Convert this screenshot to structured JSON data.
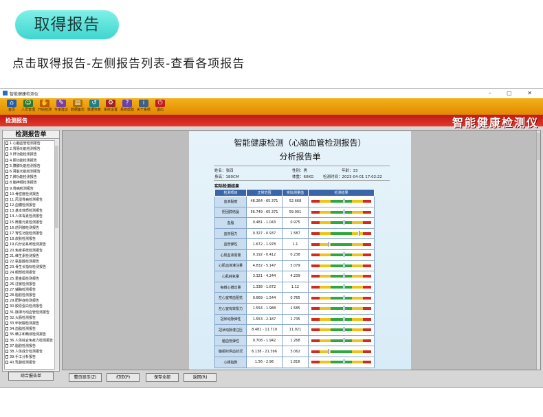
{
  "banner": {
    "title": "取得报告"
  },
  "caption": "点击取得报告-左侧报告列表-查看各项报告",
  "window": {
    "title": "智能健康检测仪",
    "controls": "–  ▢  ✕"
  },
  "toolbar": {
    "items": [
      {
        "label": "首页",
        "icon": "home-icon",
        "color": "#1f5fae"
      },
      {
        "label": "人员管理",
        "icon": "people-icon",
        "color": "#2b7a2b"
      },
      {
        "label": "开始检测",
        "icon": "hand-icon",
        "color": "#c05a00"
      },
      {
        "label": "专家建议",
        "icon": "expert-icon",
        "color": "#7b3fa0"
      },
      {
        "label": "数据备份",
        "icon": "backup-icon",
        "color": "#b07000"
      },
      {
        "label": "数据恢复",
        "icon": "restore-icon",
        "color": "#1f7e8a"
      },
      {
        "label": "系统设置",
        "icon": "settings-icon",
        "color": "#a32121"
      },
      {
        "label": "系统帮助",
        "icon": "help-icon",
        "color": "#6a3fb0"
      },
      {
        "label": "关于系统",
        "icon": "about-icon",
        "color": "#3e5f8a"
      },
      {
        "label": "退出",
        "icon": "exit-icon",
        "color": "#c41e1e"
      }
    ]
  },
  "section_label": "检测报告",
  "brand": "智能健康检测仪",
  "sidebar": {
    "title": "检测报告单",
    "items": [
      "1.心脑血管检测报告",
      "2.胃肠功能检测报告",
      "3.肝功能检测报告",
      "4.胆功能检测报告",
      "5.胰腺功能检测报告",
      "6.肾脏功能检测报告",
      "7.肺功能检测报告",
      "8.脑神经检测报告",
      "9.骨病检测报告",
      "10.骨密度检测报告",
      "11.风湿骨病检测报告",
      "12.血糖检测报告",
      "13.基本体质检测报告",
      "14.人体毒素检测报告",
      "15.微量元素检测报告",
      "16.前列腺检测报告",
      "17.胃性功能检测报告",
      "18.皮肤检测报告",
      "19.内分泌系统检测报告",
      "20.免疫系统检测报告",
      "21.维生素检测报告",
      "22.氨基酸检测报告",
      "23.骨生长指标检测报告",
      "24.眼部检测报告",
      "25.重金属检测报告",
      "26.过敏检测报告",
      "27.辅酶检测报告",
      "28.脂肪检测报告",
      "29.肥胖症检测报告",
      "30.胶原蛋白检测报告",
      "31.脉搏与动血管检测报告",
      "32.大肠检测报告",
      "33.甲状腺检测报告",
      "34.血脂检测报告",
      "35.精子和精液检测报告",
      "36.人体综合免疫力检测报告",
      "37.脂肪检测报告",
      "38.人体成分检测报告",
      "39.手工分析报告",
      "40.乳腺检测报告"
    ],
    "button": "综合报告单"
  },
  "buttons": {
    "show_full": "整页显示(Z)",
    "print": "打印(P)",
    "save_all": "保存全部",
    "back": "返回(R)"
  },
  "report": {
    "title": "智能健康检测（心脑血管检测报告）",
    "subtitle": "分析报告单",
    "name": "姓名：张四",
    "gender": "性别：男",
    "age": "年龄：33",
    "height": "身高：180CM",
    "weight": "体重：60KG",
    "time": "检测时间：2023-04-01 17:02:22",
    "section": "实际检测结果",
    "headers": [
      "检测项目",
      "正常范围",
      "实际测量值",
      "检测结果"
    ],
    "rows": [
      {
        "name": "血液黏度",
        "range": "48.264 - 65.371",
        "value": "52.668",
        "level": 0.55
      },
      {
        "name": "胆固醇结晶",
        "range": "56.749 - 65.371",
        "value": "59.901",
        "level": 0.55
      },
      {
        "name": "血脂",
        "range": "0.481 - 1.043",
        "value": "0.975",
        "level": 0.55
      },
      {
        "name": "血管阻力",
        "range": "0.327 - 0.937",
        "value": "1.587",
        "level": 0.8
      },
      {
        "name": "血管弹性",
        "range": "1.672 - 1.978",
        "value": "1.1",
        "level": 0.3
      },
      {
        "name": "心肌血液需量",
        "range": "0.192 - 0.412",
        "value": "0.238",
        "level": 0.55
      },
      {
        "name": "心肌血液灌注量",
        "range": "4.832 - 5.147",
        "value": "5.079",
        "level": 0.55
      },
      {
        "name": "心肌耗氧量",
        "range": "3.321 - 4.244",
        "value": "4.239",
        "level": 0.55
      },
      {
        "name": "每搏心搏出量",
        "range": "1.338 - 1.672",
        "value": "1.12",
        "level": 0.55
      },
      {
        "name": "左心室喷血阻抗",
        "range": "0.669 - 1.544",
        "value": "0.765",
        "level": 0.55
      },
      {
        "name": "左心室有效泵力",
        "range": "1.554 - 1.988",
        "value": "1.585",
        "level": 0.55
      },
      {
        "name": "冠状动脉弹性",
        "range": "1.553 - 2.187",
        "value": "1.735",
        "level": 0.55
      },
      {
        "name": "冠状动脉灌注压",
        "range": "8.481 - 11.719",
        "value": "11.021",
        "level": 0.55
      },
      {
        "name": "脑血管弹性",
        "range": "0.708 - 1.942",
        "value": "1.268",
        "level": 0.55
      },
      {
        "name": "脑组织供血状况",
        "range": "6.138 - 21.396",
        "value": "3.062",
        "level": 0.3
      },
      {
        "name": "心搏指数",
        "range": "1.56 - 2.96",
        "value": "1.816",
        "level": 0.55
      }
    ]
  },
  "colors": {
    "red": "#d42a1e",
    "yellow": "#f0c21c",
    "green": "#2fa83a",
    "blue": "#3a66a8"
  }
}
